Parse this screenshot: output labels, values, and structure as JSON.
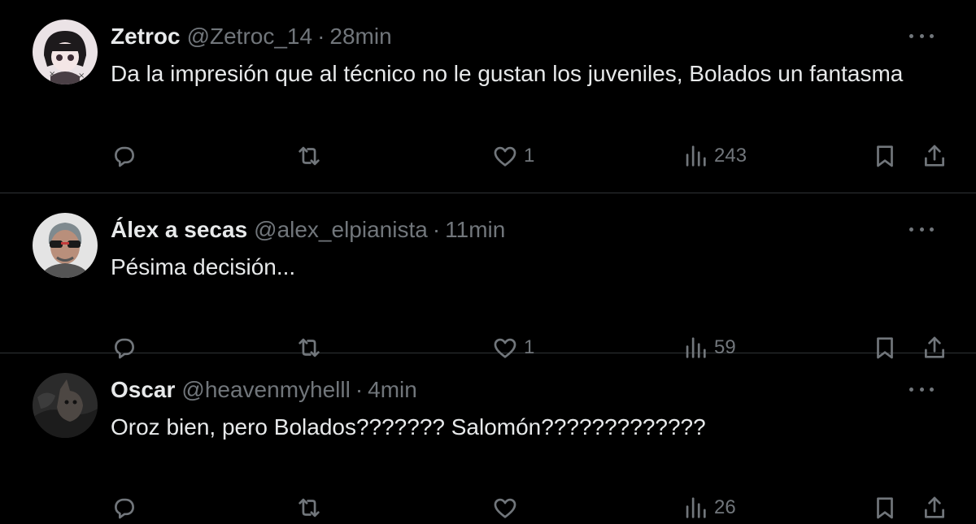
{
  "tweets": [
    {
      "name": "Zetroc",
      "handle": "@Zetroc_14",
      "separator": "·",
      "time": "28min",
      "text": "Da la impresión que al técnico no le gustan los juveniles, Bolados un fantasma",
      "likes": "1",
      "views": "243",
      "avatar_color": "#e9dfe2"
    },
    {
      "name": "Álex a secas",
      "handle": "@alex_elpianista",
      "separator": "·",
      "time": "11min",
      "text": "Pésima decisión...",
      "likes": "1",
      "views": "59",
      "avatar_color": "#e6e6e6"
    },
    {
      "name": "Oscar",
      "handle": "@heavenmyhelll",
      "separator": "·",
      "time": "4min",
      "text": "Oroz bien, pero Bolados??????? Salomón?????????????",
      "likes": "",
      "views": "26",
      "avatar_color": "#3a3a3a"
    }
  ],
  "icons": [
    "more-icon",
    "reply-icon",
    "retweet-icon",
    "like-icon",
    "views-icon",
    "bookmark-icon",
    "share-icon"
  ],
  "colors": {
    "background": "#000000",
    "text": "#e7e9ea",
    "secondary": "#71767b",
    "divider": "#2f3336"
  }
}
